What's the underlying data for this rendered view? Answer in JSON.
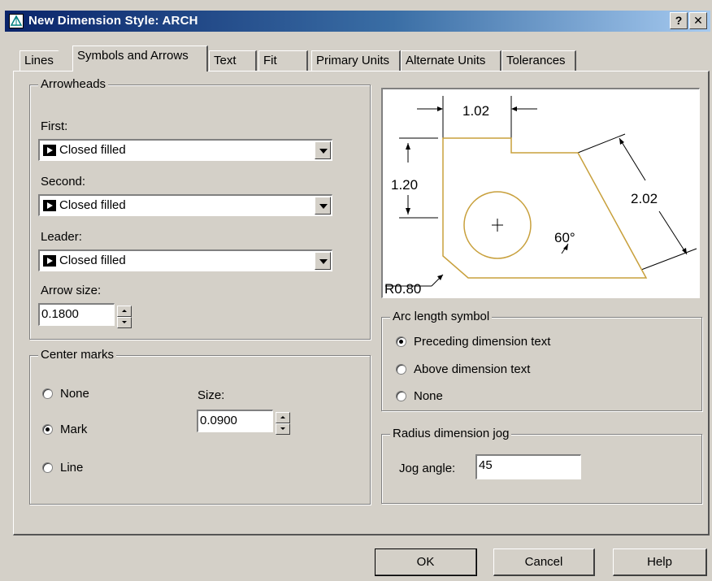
{
  "window": {
    "title": "New Dimension Style: ARCH",
    "help_label": "?",
    "close_label": "✕"
  },
  "tabs": [
    {
      "label": "Lines"
    },
    {
      "label": "Symbols and Arrows"
    },
    {
      "label": "Text"
    },
    {
      "label": "Fit"
    },
    {
      "label": "Primary Units"
    },
    {
      "label": "Alternate Units"
    },
    {
      "label": "Tolerances"
    }
  ],
  "arrowheads": {
    "legend": "Arrowheads",
    "first_label": "First:",
    "first_value": "Closed filled",
    "second_label": "Second:",
    "second_value": "Closed filled",
    "leader_label": "Leader:",
    "leader_value": "Closed filled",
    "arrow_size_label": "Arrow size:",
    "arrow_size_value": "0.1800"
  },
  "center_marks": {
    "legend": "Center marks",
    "options": [
      {
        "label": "None",
        "selected": false
      },
      {
        "label": "Mark",
        "selected": true
      },
      {
        "label": "Line",
        "selected": false
      }
    ],
    "size_label": "Size:",
    "size_value": "0.0900"
  },
  "preview": {
    "dim_top": "1.02",
    "dim_left": "1.20",
    "dim_right": "2.02",
    "dim_angle": "60°",
    "dim_radius": "R0.80",
    "outline_color": "#c8a03c"
  },
  "arc_length": {
    "legend": "Arc length symbol",
    "options": [
      {
        "label": "Preceding dimension text",
        "selected": true
      },
      {
        "label": "Above dimension text",
        "selected": false
      },
      {
        "label": "None",
        "selected": false
      }
    ]
  },
  "radius_jog": {
    "legend": "Radius dimension jog",
    "jog_angle_label": "Jog angle:",
    "jog_angle_value": "45"
  },
  "buttons": {
    "ok": "OK",
    "cancel": "Cancel",
    "help": "Help"
  }
}
